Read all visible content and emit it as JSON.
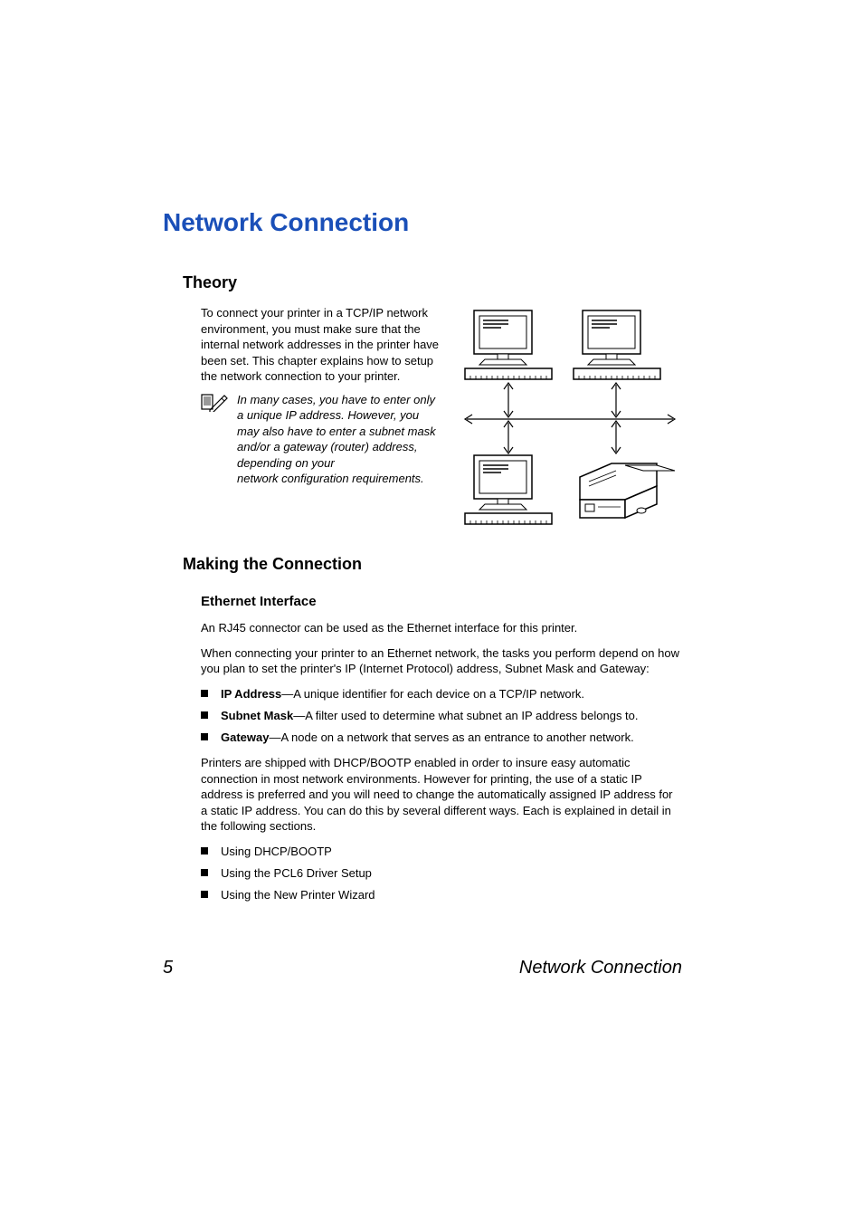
{
  "title": "Network Connection",
  "sections": {
    "theory": {
      "heading": "Theory",
      "paragraph": "To connect your printer in a TCP/IP network environment, you must make sure that the internal network addresses in the printer have been set. This chapter explains how to setup the network connection to your printer.",
      "note_top": "In many cases, you have to enter only a unique IP address. However, you may also have to enter a subnet mask and/or a gateway (router) address, depending on your",
      "note_bottom": "network configuration requirements."
    },
    "making": {
      "heading": "Making the Connection",
      "sub_heading": "Ethernet Interface",
      "p1": "An RJ45 connector can be used as the Ethernet interface for this printer.",
      "p2": "When connecting your printer to an Ethernet network, the tasks you perform depend on how you plan to set the printer's IP (Internet Protocol) address, Subnet Mask and Gateway:",
      "defs": [
        {
          "term": "IP Address",
          "desc": "—A unique identifier for each device on a TCP/IP network."
        },
        {
          "term": "Subnet Mask",
          "desc": "—A filter used to determine what subnet an IP address belongs to."
        },
        {
          "term": "Gateway",
          "desc": "—A node on a network that serves as an entrance to another network."
        }
      ],
      "p3": "Printers are shipped with DHCP/BOOTP enabled in order to insure easy automatic connection in most network environments. However for printing, the use of a static IP address is preferred and you will need to change the automatically assigned IP address for a static IP address. You can do this by several different ways. Each is explained in detail in the following sections.",
      "methods": [
        "Using DHCP/BOOTP",
        "Using the PCL6 Driver Setup",
        "Using the New Printer Wizard"
      ]
    }
  },
  "footer": {
    "page_number": "5",
    "section_label": "Network Connection"
  }
}
